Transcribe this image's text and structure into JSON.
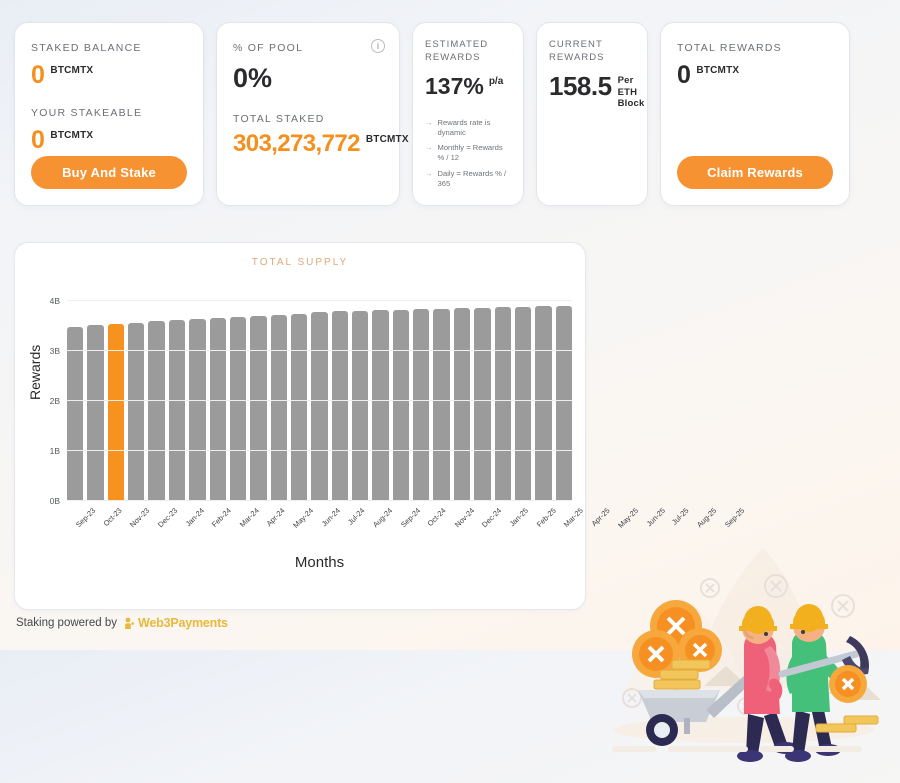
{
  "cards": {
    "staked_balance": {
      "label": "STAKED BALANCE",
      "value": "0",
      "unit": "BTCMTX",
      "stakeable_label": "YOUR STAKEABLE",
      "stakeable_value": "0",
      "stakeable_unit": "BTCMTX",
      "button": "Buy And Stake"
    },
    "pool": {
      "label": "% OF POOL",
      "value": "0%",
      "info_icon": "info-icon",
      "total_staked_label": "TOTAL STAKED",
      "total_staked_value": "303,273,772",
      "total_staked_unit": "BTCMTX"
    },
    "estimated": {
      "label": "ESTIMATED REWARDS",
      "value": "137%",
      "suffix": "p/a",
      "bullets": [
        "Rewards rate is dynamic",
        "Monthly = Rewards % / 12",
        "Daily = Rewards % / 365"
      ]
    },
    "current": {
      "label": "CURRENT REWARDS",
      "value": "158.5",
      "unit": "Per ETH Block"
    },
    "total_rewards": {
      "label": "TOTAL REWARDS",
      "value": "0",
      "unit": "BTCMTX",
      "button": "Claim Rewards"
    }
  },
  "footer": {
    "text": "Staking powered by",
    "brand": "Web3Payments"
  },
  "colors": {
    "accent_orange": "#f7921e",
    "bar_gray": "#9b9b9b",
    "brand_yellow": "#e8b93a",
    "title_peach": "#e0a878"
  },
  "chart_data": {
    "type": "bar",
    "title": "TOTAL SUPPLY",
    "xlabel": "Months",
    "ylabel": "Rewards",
    "ylim": [
      0,
      4000000000
    ],
    "ytick_labels": [
      "0B",
      "1B",
      "2B",
      "3B",
      "4B"
    ],
    "ytick_values": [
      0,
      1000000000,
      2000000000,
      3000000000,
      4000000000
    ],
    "grid": true,
    "legend": "none",
    "highlight_index": 2,
    "highlight_color": "#f7921e",
    "bar_color": "#9b9b9b",
    "categories": [
      "Sep-23",
      "Oct-23",
      "Nov-23",
      "Dec-23",
      "Jan-24",
      "Feb-24",
      "Mar-24",
      "Apr-24",
      "May-24",
      "Jun-24",
      "Jul-24",
      "Aug-24",
      "Sep-24",
      "Oct-24",
      "Nov-24",
      "Dec-24",
      "Jan-25",
      "Feb-25",
      "Mar-25",
      "Apr-25",
      "May-25",
      "Jun-25",
      "Jul-25",
      "Aug-25",
      "Sep-25"
    ],
    "values": [
      3.47,
      3.5,
      3.52,
      3.54,
      3.58,
      3.6,
      3.63,
      3.65,
      3.67,
      3.69,
      3.71,
      3.73,
      3.76,
      3.78,
      3.79,
      3.81,
      3.81,
      3.82,
      3.83,
      3.84,
      3.85,
      3.86,
      3.87,
      3.88,
      3.89
    ],
    "value_unit": "B"
  }
}
